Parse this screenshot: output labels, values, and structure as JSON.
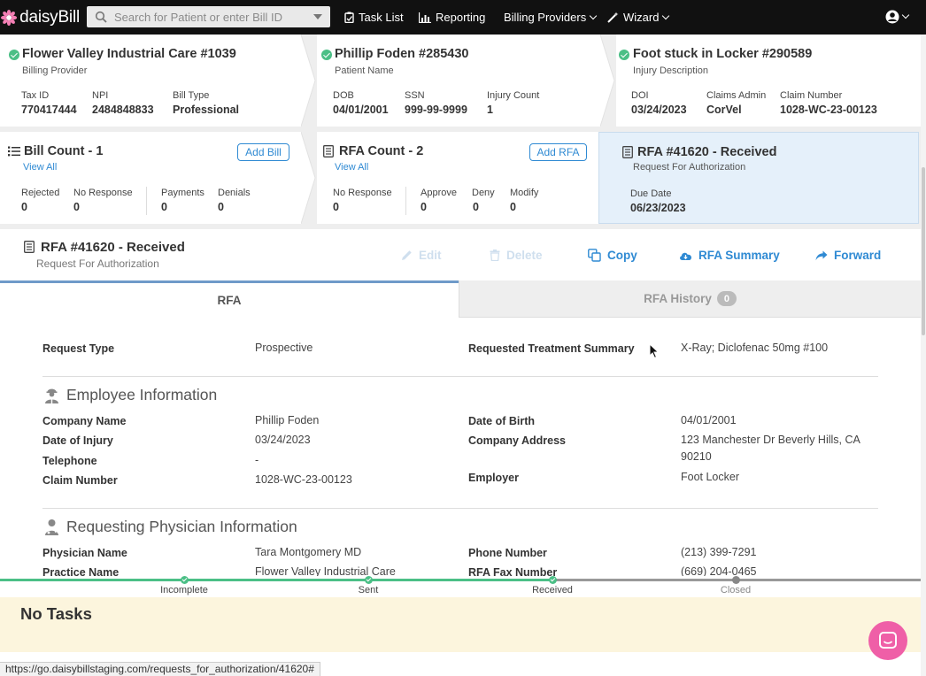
{
  "nav": {
    "brand": "daisyBill",
    "search_placeholder": "Search for Patient or enter Bill ID",
    "task_list": "Task List",
    "reporting": "Reporting",
    "billing_providers": "Billing Providers",
    "wizard": "Wizard"
  },
  "provider_card": {
    "title": "Flower Valley Industrial Care #1039",
    "subtitle": "Billing Provider",
    "fields": [
      {
        "label": "Tax ID",
        "value": "770417444"
      },
      {
        "label": "NPI",
        "value": "2484848833"
      },
      {
        "label": "Bill Type",
        "value": "Professional"
      }
    ]
  },
  "patient_card": {
    "title": "Phillip Foden #285430",
    "subtitle": "Patient Name",
    "fields": [
      {
        "label": "DOB",
        "value": "04/01/2001"
      },
      {
        "label": "SSN",
        "value": "999-99-9999"
      },
      {
        "label": "Injury Count",
        "value": "1"
      }
    ]
  },
  "injury_card": {
    "title": "Foot stuck in Locker #290589",
    "subtitle": "Injury Description",
    "fields": [
      {
        "label": "DOI",
        "value": "03/24/2023"
      },
      {
        "label": "Claims Admin",
        "value": "CorVel"
      },
      {
        "label": "Claim Number",
        "value": "1028-WC-23-00123"
      }
    ]
  },
  "bill_card": {
    "title": "Bill Count - 1",
    "link": "View All",
    "button": "Add Bill",
    "fields": [
      {
        "label": "Rejected",
        "value": "0"
      },
      {
        "label": "No Response",
        "value": "0"
      },
      {
        "label": "Payments",
        "value": "0"
      },
      {
        "label": "Denials",
        "value": "0"
      }
    ]
  },
  "rfa_count_card": {
    "title": "RFA Count - 2",
    "link": "View All",
    "button": "Add RFA",
    "fields": [
      {
        "label": "No Response",
        "value": "0"
      },
      {
        "label": "Approve",
        "value": "0"
      },
      {
        "label": "Deny",
        "value": "0"
      },
      {
        "label": "Modify",
        "value": "0"
      }
    ]
  },
  "rfa_status_card": {
    "title": "RFA #41620 - Received",
    "subtitle": "Request For Authorization",
    "due_label": "Due Date",
    "due_value": "06/23/2023"
  },
  "rfa_header": {
    "title": "RFA #41620 - Received",
    "subtitle": "Request For Authorization",
    "actions": {
      "edit": "Edit",
      "delete": "Delete",
      "copy": "Copy",
      "summary": "RFA Summary",
      "forward": "Forward"
    }
  },
  "tabs": {
    "rfa": "RFA",
    "history": "RFA History",
    "history_count": "0"
  },
  "request": {
    "type_label": "Request Type",
    "type_value": "Prospective",
    "summary_label": "Requested Treatment Summary",
    "summary_value": "X-Ray; Diclofenac 50mg #100"
  },
  "employee": {
    "heading": "Employee Information",
    "company_name_label": "Company Name",
    "company_name": "Phillip Foden",
    "doi_label": "Date of Injury",
    "doi": "03/24/2023",
    "telephone_label": "Telephone",
    "telephone": "-",
    "claim_label": "Claim Number",
    "claim": "1028-WC-23-00123",
    "dob_label": "Date of Birth",
    "dob": "04/01/2001",
    "address_label": "Company Address",
    "address_line1": "123 Manchester Dr Beverly Hills, CA",
    "address_line2": "90210",
    "employer_label": "Employer",
    "employer": "Foot Locker"
  },
  "physician": {
    "heading": "Requesting Physician Information",
    "name_label": "Physician Name",
    "name": "Tara Montgomery MD",
    "practice_label": "Practice Name",
    "practice": "Flower Valley Industrial Care",
    "phone_label": "Phone Number",
    "phone": "(213) 399-7291",
    "fax_label": "RFA Fax Number",
    "fax": "(669) 204-0465"
  },
  "progress": {
    "steps": [
      "Incomplete",
      "Sent",
      "Received",
      "Closed"
    ],
    "completed": 3
  },
  "tasks": {
    "title": "No Tasks"
  },
  "status_url": "https://go.daisybillstaging.com/requests_for_authorization/41620#",
  "colors": {
    "accent": "#2f8ad3",
    "success": "#4bbf86",
    "chat": "#ef5fa7",
    "active_card": "#e5f0fa"
  }
}
